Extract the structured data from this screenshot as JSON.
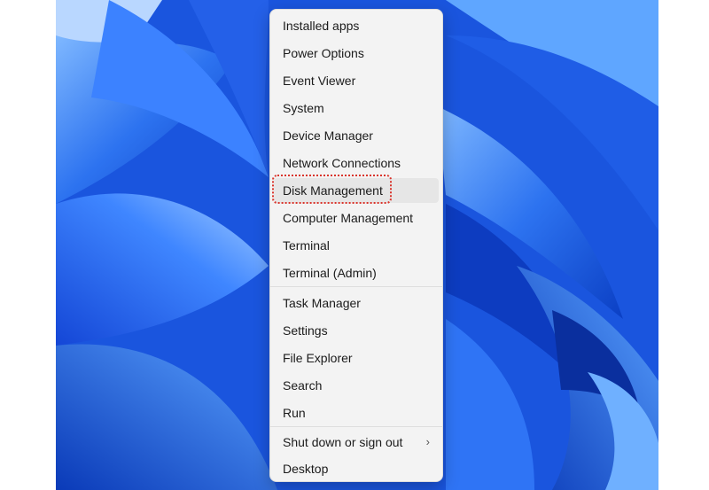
{
  "context_menu": {
    "items": [
      {
        "label": "Installed apps"
      },
      {
        "label": "Power Options"
      },
      {
        "label": "Event Viewer"
      },
      {
        "label": "System"
      },
      {
        "label": "Device Manager"
      },
      {
        "label": "Network Connections"
      },
      {
        "label": "Disk Management"
      },
      {
        "label": "Computer Management"
      },
      {
        "label": "Terminal"
      },
      {
        "label": "Terminal (Admin)"
      },
      {
        "label": "Task Manager"
      },
      {
        "label": "Settings"
      },
      {
        "label": "File Explorer"
      },
      {
        "label": "Search"
      },
      {
        "label": "Run"
      },
      {
        "label": "Shut down or sign out"
      },
      {
        "label": "Desktop"
      }
    ],
    "submenu_glyph": "›",
    "highlighted_item": "Disk Management"
  },
  "colors": {
    "wallpaper_blue": "#1f5fe6",
    "menu_background": "#f3f3f3",
    "highlight_ring": "#d9342b"
  },
  "icons": {
    "submenu": "chevron-right-icon"
  }
}
